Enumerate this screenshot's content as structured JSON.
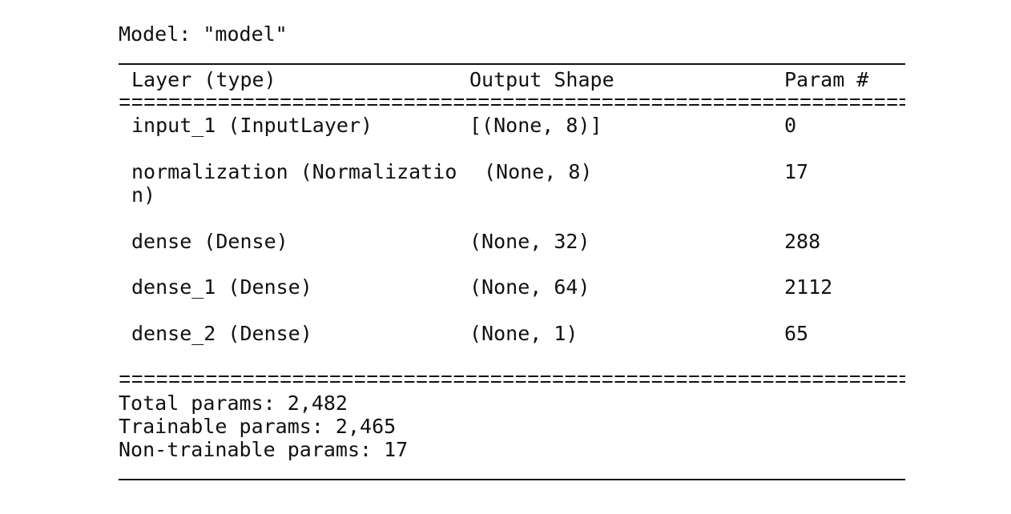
{
  "model_title": "Model: \"model\"",
  "table": {
    "headers": [
      "Layer (type)",
      "Output Shape",
      "Param #"
    ],
    "rows": [
      {
        "layer": "input_1 (InputLayer)",
        "layer_wrap": "",
        "shape": "[(None, 8)]",
        "params": "0"
      },
      {
        "layer": "normalization (Normalizatio",
        "layer_wrap": "n)",
        "shape": "(None, 8)",
        "params": "17"
      },
      {
        "layer": "dense (Dense)",
        "layer_wrap": "",
        "shape": "(None, 32)",
        "params": "288"
      },
      {
        "layer": "dense_1 (Dense)",
        "layer_wrap": "",
        "shape": "(None, 64)",
        "params": "2112"
      },
      {
        "layer": "dense_2 (Dense)",
        "layer_wrap": "",
        "shape": "(None, 1)",
        "params": "65"
      }
    ]
  },
  "summary": {
    "total": "Total params: 2,482",
    "trainable": "Trainable params: 2,465",
    "non_trainable": "Non-trainable params: 17"
  }
}
